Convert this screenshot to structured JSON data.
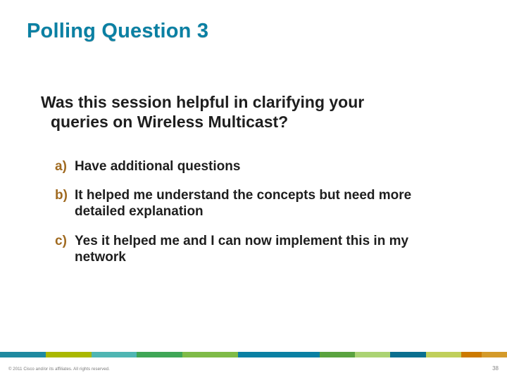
{
  "title": "Polling Question 3",
  "question_line1": "Was this session helpful in clarifying your",
  "question_line2": "queries on Wireless Multicast?",
  "options": {
    "a": {
      "marker": "a)",
      "text": "Have additional questions"
    },
    "b": {
      "marker": "b)",
      "text": "It helped me understand the concepts but need more detailed explanation"
    },
    "c": {
      "marker": "c)",
      "text": "Yes it helped me and I can now implement this in my network"
    }
  },
  "footer": {
    "copyright": "© 2011 Cisco and/or its affiliates. All rights reserved.",
    "page": "38"
  }
}
